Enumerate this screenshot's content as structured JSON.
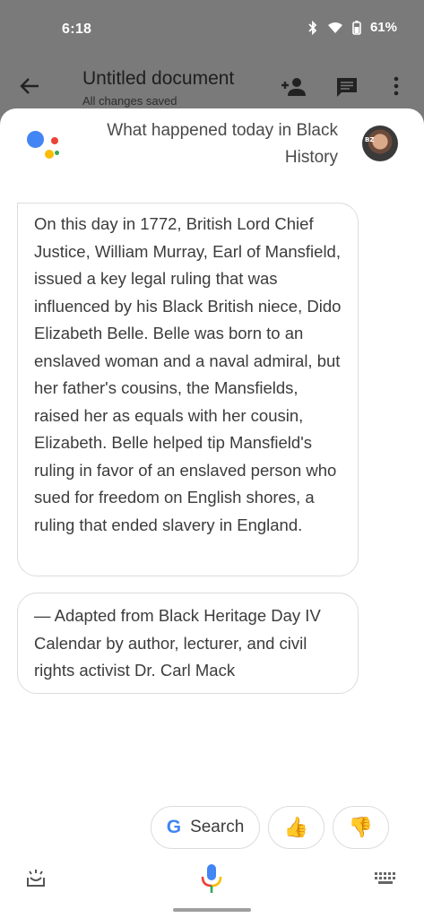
{
  "status_bar": {
    "time": "6:18",
    "battery": "61%",
    "icons": [
      "bluetooth-icon",
      "wifi-icon",
      "battery-icon"
    ]
  },
  "docs_bar": {
    "title": "Untitled document",
    "subtitle": "All changes saved",
    "icons": [
      "back-arrow-icon",
      "add-person-icon",
      "comment-icon",
      "more-vert-icon"
    ]
  },
  "assistant": {
    "query": "What happened today in Black History",
    "response": "On this day in 1772, British Lord Chief Justice, William Murray, Earl of Mansfield, issued a key legal ruling that was influenced by his Black British niece, Dido Elizabeth Belle. Belle was born to an enslaved woman and a naval admiral, but her father's cousins, the Mansfields, raised her as equals with her cousin, Elizabeth. Belle helped tip Mansfield's ruling in favor of an enslaved person who sued for freedom on English shores, a ruling that ended slavery in England.",
    "source": "— Adapted from Black Heritage Day IV Calendar by author, lecturer, and civil rights activist Dr. Carl Mack",
    "avatar_tag": "BZ",
    "chips": {
      "search_label": "Search",
      "thumbs_up": "👍",
      "thumbs_down": "👎"
    }
  },
  "colors": {
    "google_blue": "#4285f4",
    "google_red": "#ea4335",
    "google_yellow": "#fbbc04",
    "google_green": "#34a853"
  }
}
